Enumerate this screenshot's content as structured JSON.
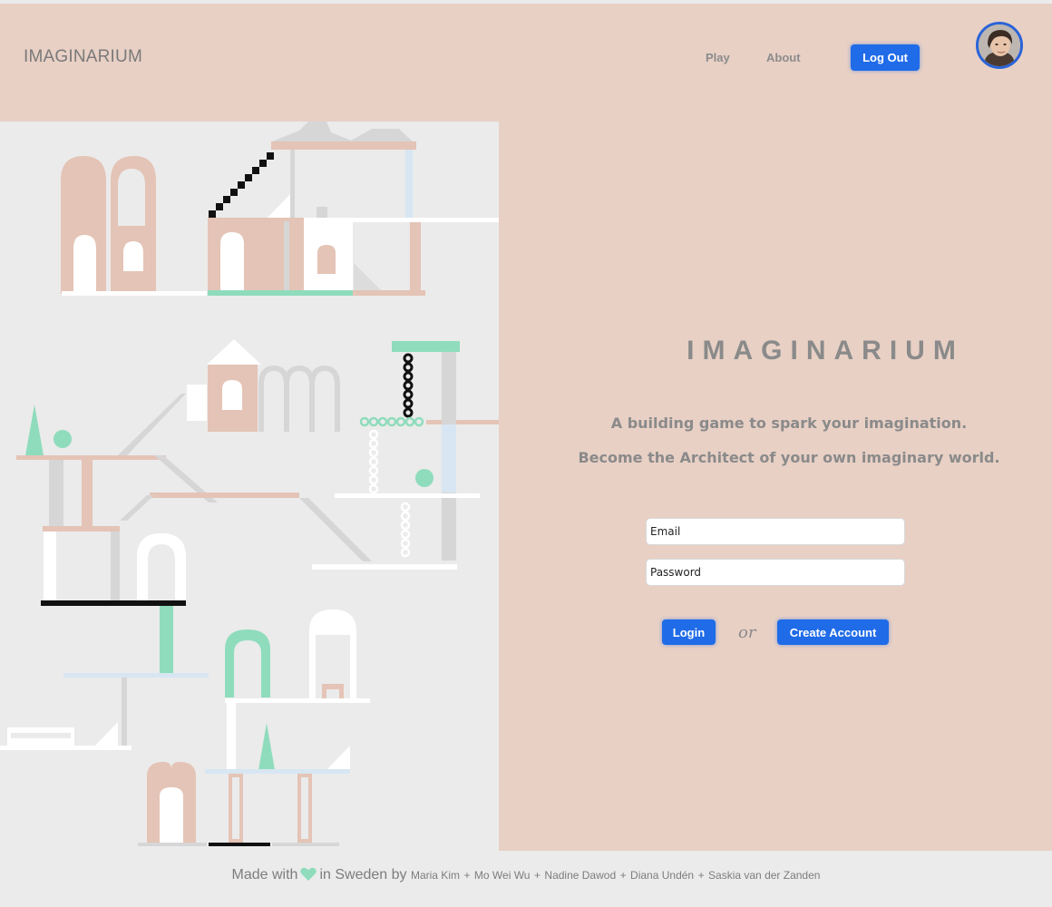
{
  "header": {
    "logo": "IMAGINARIUM",
    "nav": {
      "play": "Play",
      "about": "About"
    },
    "logout_label": "Log Out"
  },
  "panel": {
    "title": "IMAGINARIUM",
    "tagline1": "A building game to spark your imagination.",
    "tagline2": "Become the Architect of your own imaginary world.",
    "email_placeholder": "Email",
    "password_placeholder": "Password",
    "login_label": "Login",
    "or_label": "or",
    "create_label": "Create Account"
  },
  "footer": {
    "made_with": "Made with",
    "in_sweden_by": "in Sweden by",
    "authors": [
      "Maria Kim",
      "Mo Wei Wu",
      "Nadine Dawod",
      "Diana Undén",
      "Saskia van der Zanden"
    ],
    "separator": "+"
  },
  "icons": {
    "heart": "heart-icon",
    "avatar": "user-avatar"
  },
  "colors": {
    "header_bg": "#e8d0c5",
    "accent_button": "#1f6be8",
    "illustration_pink": "#e4c4b6",
    "illustration_mint": "#8fdcbd",
    "page_bg": "#ebebeb"
  }
}
